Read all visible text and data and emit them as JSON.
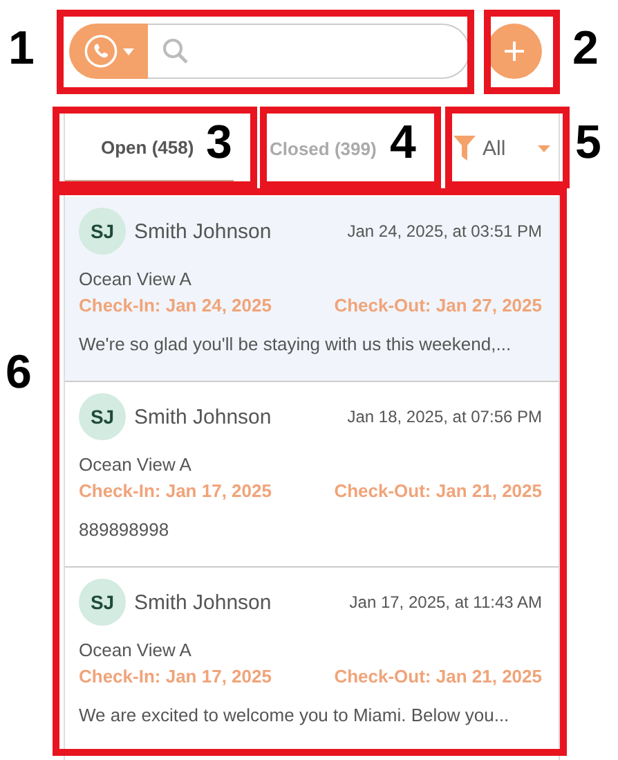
{
  "toolbar": {
    "channel_button": {
      "kind": "phone"
    }
  },
  "tabs": [
    {
      "label": "Open (458)",
      "selected": true
    },
    {
      "label": "Closed (399)",
      "selected": false
    }
  ],
  "filter": {
    "label": "All"
  },
  "conversations": [
    {
      "initials": "SJ",
      "name": "Smith Johnson",
      "time": "Jan 24, 2025, at 03:51 PM",
      "property": "Ocean View A",
      "check_in": "Check-In: Jan 24, 2025",
      "check_out": "Check-Out: Jan 27, 2025",
      "message": "We're so glad you'll be staying with us this weekend,...",
      "selected": true
    },
    {
      "initials": "SJ",
      "name": "Smith Johnson",
      "time": "Jan 18, 2025, at 07:56 PM",
      "property": "Ocean View A",
      "check_in": "Check-In: Jan 17, 2025",
      "check_out": "Check-Out: Jan 21, 2025",
      "message": "889898998",
      "selected": false
    },
    {
      "initials": "SJ",
      "name": "Smith Johnson",
      "time": "Jan 17, 2025, at 11:43 AM",
      "property": "Ocean View A",
      "check_in": "Check-In: Jan 17, 2025",
      "check_out": "Check-Out: Jan 21, 2025",
      "message": "We are excited to welcome you to Miami. Below you...",
      "selected": false
    }
  ],
  "annotations": [
    {
      "label": "1"
    },
    {
      "label": "2"
    },
    {
      "label": "3"
    },
    {
      "label": "4"
    },
    {
      "label": "5"
    },
    {
      "label": "6"
    }
  ]
}
